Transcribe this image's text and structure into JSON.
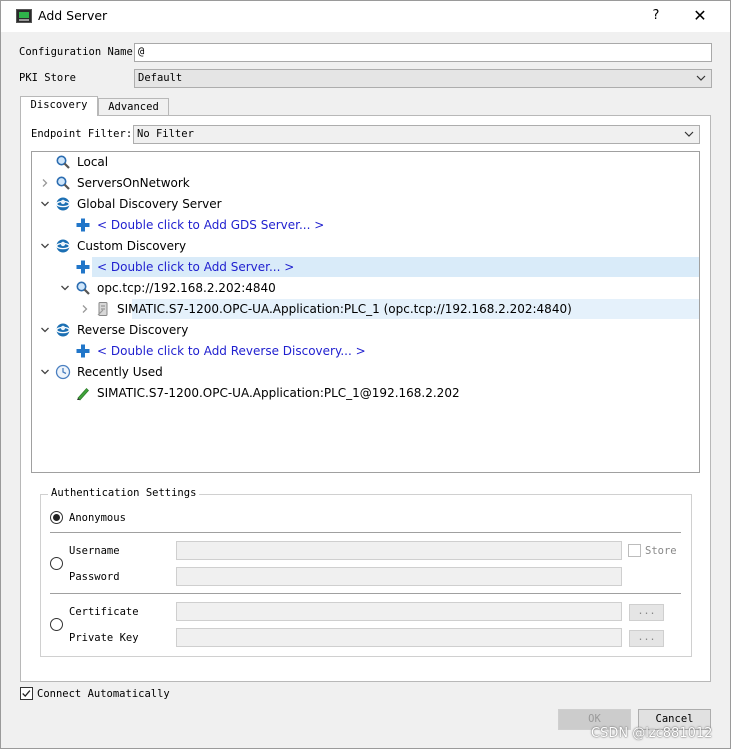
{
  "window": {
    "title": "Add Server",
    "help_label": "?",
    "close_label": "✕"
  },
  "config": {
    "name_label": "Configuration Name",
    "name_value": "@",
    "pki_label": "PKI Store",
    "pki_value": "Default"
  },
  "tabs": [
    {
      "label": "Discovery",
      "active": true
    },
    {
      "label": "Advanced",
      "active": false
    }
  ],
  "discovery": {
    "endpoint_filter_label": "Endpoint Filter:",
    "endpoint_filter_value": "No Filter",
    "tree": [
      {
        "label": "Local",
        "icon": "magnifier-icon",
        "expander": "none",
        "level": 0
      },
      {
        "label": "ServersOnNetwork",
        "icon": "magnifier-icon",
        "expander": "collapsed",
        "level": 0
      },
      {
        "label": "Global Discovery Server",
        "icon": "globe-icon",
        "expander": "expanded",
        "level": 0
      },
      {
        "label": "< Double click to Add GDS Server... >",
        "icon": "plus-icon",
        "expander": "none",
        "level": 1,
        "link": true
      },
      {
        "label": "Custom Discovery",
        "icon": "globe-icon",
        "expander": "expanded",
        "level": 0
      },
      {
        "label": "< Double click to Add Server... >",
        "icon": "plus-icon",
        "expander": "none",
        "level": 1,
        "link": true,
        "selected": true
      },
      {
        "label": "opc.tcp://192.168.2.202:4840",
        "icon": "magnifier-icon",
        "expander": "expanded",
        "level": 1
      },
      {
        "label": "SIMATIC.S7-1200.OPC-UA.Application:PLC_1 (opc.tcp://192.168.2.202:4840)",
        "icon": "server-icon",
        "expander": "collapsed",
        "level": 2,
        "hover": true
      },
      {
        "label": "Reverse Discovery",
        "icon": "globe-icon",
        "expander": "expanded",
        "level": 0
      },
      {
        "label": "< Double click to Add Reverse Discovery... >",
        "icon": "plus-icon",
        "expander": "none",
        "level": 1,
        "link": true
      },
      {
        "label": "Recently Used",
        "icon": "clock-icon",
        "expander": "expanded",
        "level": 0
      },
      {
        "label": "SIMATIC.S7-1200.OPC-UA.Application:PLC_1@192.168.2.202",
        "icon": "pencil-icon",
        "expander": "none",
        "level": 1
      }
    ]
  },
  "auth": {
    "title": "Authentication Settings",
    "anonymous_label": "Anonymous",
    "username_label": "Username",
    "password_label": "Password",
    "store_label": "Store",
    "certificate_label": "Certificate",
    "private_key_label": "Private Key",
    "browse_label": "...",
    "selected": "anonymous"
  },
  "connect_auto_label": "Connect Automatically",
  "connect_auto_checked": true,
  "ok_label": "OK",
  "cancel_label": "Cancel",
  "watermark": "CSDN @lzc881012",
  "colors": {
    "link": "#1f1fcf",
    "selection": "#d9ebf9",
    "globe": "#1b6fb3"
  }
}
